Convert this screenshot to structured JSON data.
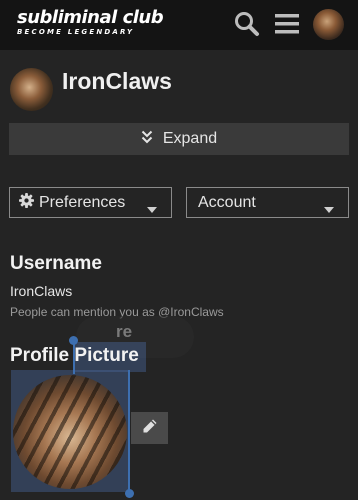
{
  "header": {
    "logo_title": "subliminal club",
    "logo_tagline": "BECOME LEGENDARY",
    "icons": [
      "search-icon",
      "hamburger-menu-icon",
      "user-avatar"
    ]
  },
  "profile": {
    "name": "IronClaws"
  },
  "expand": {
    "label": "Expand",
    "icon": "double-chevron-down-icon"
  },
  "dropdowns": {
    "preferences": {
      "label": "Preferences",
      "icon": "gear-icon"
    },
    "account": {
      "label": "Account"
    }
  },
  "username_section": {
    "title": "Username",
    "value": "IronClaws",
    "hint": "People can mention you as @IronClaws"
  },
  "ghost_text": "re",
  "picture_section": {
    "title": "Profile Picture",
    "edit_icon": "pencil-icon"
  },
  "colors": {
    "background": "#242424",
    "header": "#141414",
    "selection": "#3d6fb0",
    "button": "#3a3a3a"
  }
}
